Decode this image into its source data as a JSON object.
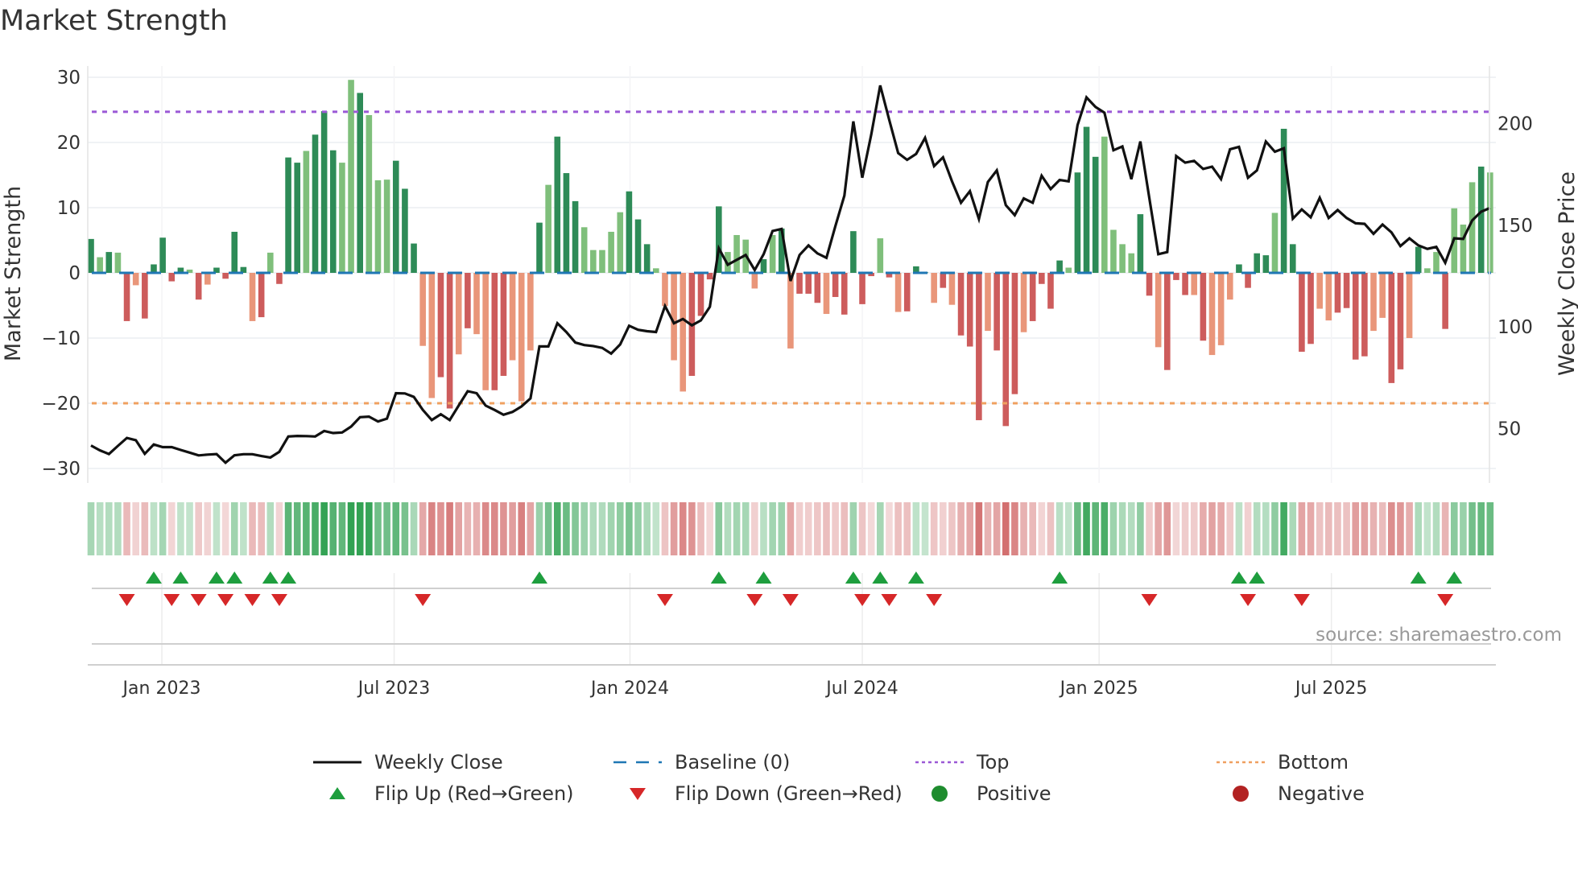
{
  "title": "Market Strength",
  "source": "source: sharemaestro.com",
  "colors": {
    "pos_strong": "#2e8b57",
    "pos_weak": "#7fbf7b",
    "neg_strong": "#cd5c5c",
    "neg_weak": "#e9967a",
    "line": "#111111",
    "baseline": "#1f77b4",
    "top": "#9b59d6",
    "bottom": "#f0a060",
    "flip_up": "#1e9e3e",
    "flip_down": "#d62728",
    "positive": "#1e8c2e",
    "negative": "#b22222"
  },
  "legend": [
    {
      "label": "Weekly Close",
      "type": "line"
    },
    {
      "label": "Baseline (0)",
      "type": "baseline"
    },
    {
      "label": "Top",
      "type": "top"
    },
    {
      "label": "Bottom",
      "type": "bottom"
    },
    {
      "label": "Flip Up (Red→Green)",
      "type": "flip_up"
    },
    {
      "label": "Flip Down (Green→Red)",
      "type": "flip_down"
    },
    {
      "label": "Positive",
      "type": "positive"
    },
    {
      "label": "Negative",
      "type": "negative"
    }
  ],
  "chart_data": {
    "type": "bar",
    "title": "Market Strength",
    "ylabel": "Market Strength",
    "y2label": "Weekly Close Price",
    "ylim": [
      -32,
      32
    ],
    "yticks": [
      30,
      20,
      10,
      0,
      -10,
      -20,
      -30
    ],
    "ytick_labels": [
      "30",
      "20",
      "10",
      "0",
      "−10",
      "−20",
      "−30"
    ],
    "y2lim": [
      30.4,
      222.8
    ],
    "y2ticks": [
      200,
      150,
      100,
      50
    ],
    "y2tick_labels": [
      "200",
      "150",
      "100",
      "50"
    ],
    "top_level": 24.7,
    "bottom_level": -20,
    "x_unit": "week index",
    "xticks": [
      {
        "label": "Jan 2023",
        "week": 7.9
      },
      {
        "label": "Jul 2023",
        "week": 33.8
      },
      {
        "label": "Jan 2024",
        "week": 60.1
      },
      {
        "label": "Jul 2024",
        "week": 86.0
      },
      {
        "label": "Jan 2025",
        "week": 112.4
      },
      {
        "label": "Jul 2025",
        "week": 138.3
      }
    ],
    "strength": [
      5.2,
      2.4,
      3.2,
      3.1,
      -7.4,
      -1.9,
      -7.0,
      1.3,
      5.4,
      -1.3,
      0.8,
      0.5,
      -4.1,
      -1.8,
      0.8,
      -0.9,
      6.3,
      0.9,
      -7.4,
      -6.8,
      3.1,
      -1.7,
      17.7,
      16.9,
      18.7,
      21.2,
      24.8,
      18.8,
      16.9,
      29.6,
      27.6,
      24.2,
      14.2,
      14.3,
      17.2,
      12.9,
      4.5,
      -11.2,
      -19.2,
      -16.0,
      -20.8,
      -12.5,
      -8.5,
      -9.4,
      -18.0,
      -18.0,
      -15.8,
      -13.4,
      -19.7,
      -11.9,
      7.7,
      13.5,
      20.9,
      15.3,
      11.0,
      7.0,
      3.5,
      3.5,
      6.3,
      9.3,
      12.5,
      8.2,
      4.4,
      0.7,
      -5.1,
      -13.4,
      -18.2,
      -15.8,
      -6.6,
      -1.0,
      10.2,
      3.2,
      5.8,
      5.1,
      -2.4,
      2.1,
      5.8,
      6.8,
      -11.6,
      -3.2,
      -3.2,
      -4.6,
      -6.3,
      -3.7,
      -6.4,
      6.4,
      -4.8,
      -0.5,
      5.3,
      -0.7,
      -6.0,
      -5.9,
      1.0,
      0.1,
      -4.6,
      -2.3,
      -4.9,
      -9.6,
      -11.3,
      -22.6,
      -8.9,
      -11.9,
      -23.5,
      -18.6,
      -9.1,
      -7.4,
      -1.7,
      -5.5,
      1.9,
      0.8,
      15.4,
      22.4,
      17.8,
      20.9,
      6.6,
      4.4,
      3.0,
      9.0,
      -3.5,
      -11.4,
      -14.9,
      -1.1,
      -3.4,
      -3.4,
      -10.4,
      -12.6,
      -11.1,
      -4.1,
      1.3,
      -2.3,
      3.0,
      2.7,
      9.2,
      22.1,
      4.4,
      -12.1,
      -10.9,
      -5.5,
      -7.3,
      -6.1,
      -5.4,
      -13.3,
      -12.8,
      -8.9,
      -6.9,
      -16.9,
      -14.8,
      -10.0,
      4.0,
      0.7,
      3.2,
      -8.6,
      9.9,
      7.4,
      13.9,
      16.3,
      15.4
    ],
    "shade": "dldldldddddldlddddldldddldddlldllldddllddldllddllldldddllllldddllllddddlllldldldddldddddldldddldldddldddlddddldddllllddldddldlllddddlddddllddddllddldlldllldlldlddddldddl",
    "weekly_close": [
      41.7,
      39.3,
      37.5,
      41.5,
      45.4,
      44.3,
      37.6,
      42.2,
      40.9,
      40.9,
      39.5,
      38.2,
      36.8,
      37.2,
      37.5,
      33.2,
      36.9,
      37.4,
      37.4,
      36.5,
      35.8,
      38.6,
      46.1,
      46.4,
      46.3,
      46.1,
      48.8,
      47.8,
      48.1,
      51.0,
      55.6,
      55.9,
      53.5,
      54.9,
      67.4,
      67.3,
      65.6,
      59.2,
      54.2,
      57.1,
      54.2,
      61.3,
      68.4,
      67.4,
      61.3,
      59.2,
      56.8,
      58.2,
      60.9,
      64.9,
      90.4,
      90.4,
      101.8,
      97.5,
      92.3,
      91.1,
      90.6,
      89.7,
      86.9,
      91.4,
      100.6,
      98.6,
      97.9,
      97.5,
      110.3,
      101.8,
      103.9,
      100.8,
      103.2,
      109.9,
      138.7,
      130.6,
      133.0,
      135.4,
      128.0,
      135.8,
      147.2,
      148.2,
      122.6,
      135.4,
      140.1,
      136.2,
      134.0,
      149.6,
      164.6,
      201.1,
      173.4,
      194.7,
      218.8,
      201.8,
      185.5,
      182.2,
      185.1,
      193.0,
      179.1,
      183.4,
      171.7,
      161.1,
      166.8,
      153.1,
      171.3,
      177.0,
      159.9,
      155.0,
      163.2,
      161.1,
      174.4,
      167.8,
      172.3,
      171.6,
      199.3,
      212.9,
      208.2,
      205.4,
      186.9,
      188.8,
      172.7,
      191.2,
      163.5,
      135.8,
      136.8,
      184.1,
      180.8,
      181.7,
      177.7,
      178.8,
      172.7,
      187.4,
      188.6,
      173.4,
      177.0,
      191.2,
      186.2,
      187.9,
      153.3,
      157.8,
      153.9,
      163.5,
      153.6,
      157.5,
      153.6,
      151.0,
      150.7,
      145.8,
      150.4,
      146.5,
      139.8,
      143.6,
      140.1,
      138.4,
      139.4,
      131.6,
      143.6,
      143.3,
      152.4,
      156.7,
      158.5
    ],
    "flip_up_weeks": [
      7,
      10,
      14,
      16,
      20,
      22,
      50,
      70,
      75,
      85,
      88,
      92,
      108,
      128,
      130,
      148,
      152
    ],
    "flip_down_weeks": [
      4,
      9,
      12,
      15,
      18,
      21,
      37,
      64,
      74,
      78,
      86,
      89,
      94,
      118,
      129,
      135,
      151
    ]
  }
}
